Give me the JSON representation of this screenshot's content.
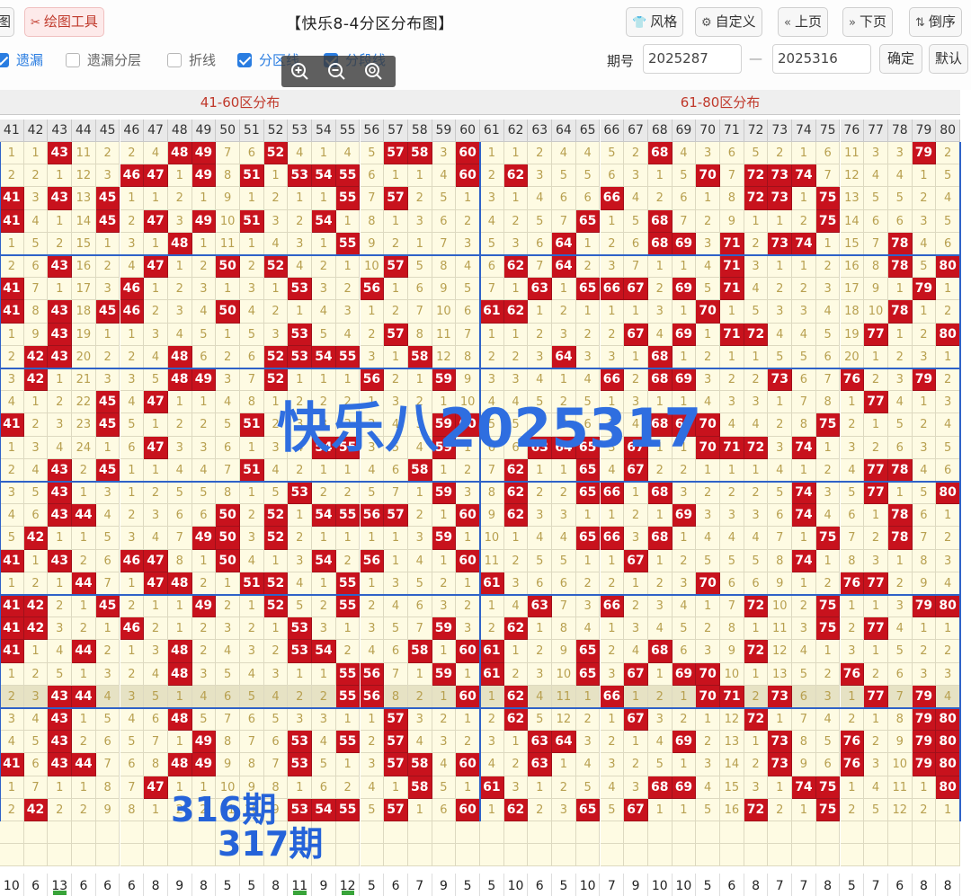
{
  "toolbar": {
    "left_partial_label": "图",
    "draw_tool_label": "绘图工具",
    "title": "【快乐8-4分区分布图】",
    "style_label": "风格",
    "custom_label": "自定义",
    "prev_label": "上页",
    "next_label": "下页",
    "reverse_label": "倒序",
    "confirm_label": "确定",
    "default_label": "默认",
    "issue_label": "期号",
    "issue_from": "2025287",
    "issue_to": "2025316",
    "dash": "—"
  },
  "options": [
    {
      "label": "遗漏",
      "checked": true
    },
    {
      "label": "遗漏分层",
      "checked": false
    },
    {
      "label": "折线",
      "checked": false
    },
    {
      "label": "分区线",
      "checked": true
    },
    {
      "label": "分段线",
      "checked": true
    }
  ],
  "zones": [
    {
      "label": "41-60区分布"
    },
    {
      "label": "61-80区分布"
    }
  ],
  "columns": [
    41,
    42,
    43,
    44,
    45,
    46,
    47,
    48,
    49,
    50,
    51,
    52,
    53,
    54,
    55,
    56,
    57,
    58,
    59,
    60,
    61,
    62,
    63,
    64,
    65,
    66,
    67,
    68,
    69,
    70,
    71,
    72,
    73,
    74,
    75,
    76,
    77,
    78,
    79,
    80
  ],
  "rows": [
    [
      1,
      1,
      "H",
      11,
      2,
      2,
      4,
      "H",
      "H",
      7,
      6,
      "H",
      4,
      1,
      4,
      5,
      "H",
      "H",
      3,
      "H",
      1,
      1,
      2,
      4,
      4,
      5,
      2,
      "H",
      4,
      3,
      6,
      5,
      2,
      1,
      6,
      11,
      3,
      3,
      "H",
      2
    ],
    [
      2,
      2,
      1,
      12,
      3,
      "H",
      "H",
      1,
      "H",
      8,
      "H",
      1,
      "H",
      "H",
      "H",
      6,
      1,
      1,
      4,
      "H",
      2,
      "H",
      3,
      5,
      5,
      6,
      3,
      1,
      5,
      "H",
      7,
      "H",
      "H",
      "H",
      7,
      12,
      4,
      4,
      1,
      5
    ],
    [
      "H",
      3,
      "H",
      13,
      "H",
      1,
      1,
      2,
      1,
      9,
      1,
      2,
      1,
      1,
      "H",
      7,
      "H",
      2,
      5,
      1,
      3,
      1,
      4,
      6,
      6,
      "H",
      4,
      2,
      6,
      1,
      8,
      "H",
      "H",
      1,
      "H",
      13,
      5,
      5,
      2,
      4
    ],
    [
      "H",
      4,
      1,
      14,
      "H",
      2,
      "H",
      3,
      "H",
      10,
      "H",
      3,
      2,
      "H",
      1,
      8,
      1,
      3,
      6,
      2,
      4,
      2,
      5,
      7,
      "H",
      1,
      5,
      "H",
      7,
      2,
      9,
      1,
      1,
      2,
      "H",
      14,
      6,
      6,
      3,
      5
    ],
    [
      1,
      5,
      2,
      15,
      1,
      3,
      1,
      "H",
      1,
      11,
      1,
      4,
      3,
      1,
      "H",
      9,
      2,
      1,
      7,
      3,
      5,
      3,
      6,
      "H",
      1,
      2,
      6,
      "H",
      "H",
      3,
      "H",
      2,
      "H",
      "H",
      1,
      15,
      7,
      "H",
      4,
      6
    ],
    [
      2,
      6,
      "H",
      16,
      2,
      4,
      "H",
      1,
      2,
      "H",
      2,
      "H",
      4,
      2,
      1,
      10,
      "H",
      5,
      8,
      4,
      6,
      "H",
      7,
      "H",
      2,
      3,
      7,
      1,
      1,
      4,
      "H",
      3,
      1,
      1,
      2,
      16,
      8,
      "H",
      5,
      "H"
    ],
    [
      "H",
      7,
      1,
      17,
      3,
      "H",
      1,
      2,
      3,
      1,
      3,
      1,
      "H",
      3,
      2,
      "H",
      1,
      6,
      9,
      5,
      7,
      1,
      "H",
      1,
      "H",
      "H",
      "H",
      2,
      "H",
      5,
      "H",
      4,
      2,
      2,
      3,
      17,
      9,
      1,
      "H",
      1
    ],
    [
      "H",
      8,
      "H",
      18,
      "H",
      "H",
      2,
      3,
      4,
      "H",
      4,
      2,
      1,
      4,
      3,
      1,
      2,
      7,
      10,
      6,
      "H",
      "H",
      1,
      2,
      1,
      1,
      1,
      3,
      1,
      "H",
      1,
      5,
      3,
      3,
      4,
      18,
      10,
      "H",
      1,
      2
    ],
    [
      1,
      9,
      "H",
      19,
      1,
      1,
      3,
      4,
      5,
      1,
      5,
      3,
      "H",
      5,
      4,
      2,
      "H",
      8,
      11,
      7,
      1,
      1,
      2,
      3,
      2,
      2,
      "H",
      4,
      "H",
      1,
      "H",
      "H",
      4,
      4,
      5,
      19,
      "H",
      1,
      2,
      "H"
    ],
    [
      2,
      "H",
      "H",
      20,
      2,
      2,
      4,
      "H",
      6,
      2,
      6,
      "H",
      "H",
      "H",
      "H",
      3,
      1,
      "H",
      12,
      8,
      2,
      2,
      3,
      "H",
      3,
      3,
      1,
      "H",
      1,
      2,
      1,
      1,
      5,
      5,
      6,
      20,
      1,
      2,
      3,
      1
    ],
    [
      3,
      "H",
      1,
      21,
      3,
      3,
      5,
      "H",
      "H",
      3,
      7,
      "H",
      1,
      1,
      1,
      "H",
      2,
      1,
      "H",
      9,
      3,
      3,
      4,
      1,
      4,
      "H",
      2,
      "H",
      "H",
      3,
      2,
      2,
      "H",
      6,
      7,
      "H",
      2,
      3,
      "H",
      2
    ],
    [
      4,
      1,
      2,
      22,
      "H",
      4,
      "H",
      1,
      1,
      4,
      8,
      1,
      2,
      2,
      2,
      1,
      3,
      2,
      1,
      10,
      4,
      4,
      5,
      2,
      5,
      1,
      3,
      1,
      1,
      4,
      3,
      3,
      1,
      7,
      8,
      1,
      "H",
      4,
      1,
      3
    ],
    [
      "H",
      2,
      3,
      23,
      "H",
      5,
      1,
      2,
      2,
      5,
      "H",
      2,
      3,
      3,
      3,
      2,
      4,
      3,
      "H",
      "H",
      5,
      5,
      6,
      3,
      6,
      2,
      4,
      "H",
      "H",
      "H",
      4,
      4,
      2,
      8,
      "H",
      2,
      1,
      5,
      2,
      4
    ],
    [
      1,
      3,
      4,
      24,
      1,
      6,
      "H",
      3,
      3,
      6,
      1,
      3,
      4,
      "H",
      "H",
      3,
      5,
      4,
      "H",
      1,
      6,
      6,
      "H",
      "H",
      "H",
      3,
      "H",
      1,
      1,
      "H",
      "H",
      "H",
      3,
      "H",
      1,
      3,
      2,
      6,
      3,
      5
    ],
    [
      2,
      4,
      "H",
      2,
      "H",
      1,
      1,
      4,
      4,
      7,
      "H",
      4,
      2,
      1,
      1,
      4,
      6,
      "H",
      1,
      2,
      7,
      "H",
      1,
      1,
      "H",
      4,
      "H",
      2,
      2,
      1,
      1,
      1,
      4,
      1,
      2,
      4,
      "H",
      "H",
      4,
      6
    ],
    [
      3,
      5,
      "H",
      1,
      3,
      1,
      2,
      5,
      5,
      8,
      1,
      5,
      "H",
      2,
      2,
      5,
      7,
      1,
      "H",
      3,
      8,
      "H",
      2,
      2,
      "H",
      "H",
      1,
      "H",
      3,
      2,
      2,
      2,
      5,
      "H",
      3,
      5,
      "H",
      1,
      5,
      "H"
    ],
    [
      4,
      6,
      "H",
      "H",
      4,
      2,
      3,
      6,
      6,
      "H",
      2,
      "H",
      1,
      "H",
      "H",
      "H",
      "H",
      2,
      1,
      "H",
      9,
      "H",
      3,
      3,
      1,
      1,
      2,
      1,
      "H",
      3,
      3,
      3,
      6,
      "H",
      4,
      6,
      1,
      "H",
      6,
      1
    ],
    [
      5,
      "H",
      1,
      1,
      5,
      3,
      4,
      7,
      "H",
      "H",
      3,
      "H",
      2,
      1,
      1,
      1,
      1,
      3,
      "H",
      1,
      10,
      1,
      4,
      4,
      "H",
      "H",
      3,
      "H",
      1,
      4,
      4,
      4,
      7,
      1,
      "H",
      7,
      2,
      "H",
      7,
      2
    ],
    [
      "H",
      1,
      "H",
      2,
      6,
      "H",
      "H",
      8,
      1,
      "H",
      4,
      1,
      3,
      "H",
      2,
      "H",
      1,
      4,
      1,
      "H",
      11,
      2,
      5,
      5,
      1,
      1,
      "H",
      1,
      2,
      5,
      5,
      5,
      8,
      "H",
      1,
      8,
      3,
      1,
      8,
      3
    ],
    [
      1,
      2,
      1,
      "H",
      7,
      1,
      "H",
      "H",
      2,
      1,
      "H",
      "H",
      4,
      1,
      "H",
      1,
      3,
      5,
      2,
      1,
      "H",
      3,
      6,
      6,
      2,
      2,
      1,
      2,
      3,
      "H",
      6,
      6,
      9,
      1,
      2,
      "H",
      "H",
      2,
      9,
      4
    ],
    [
      "H",
      "H",
      2,
      1,
      "H",
      2,
      1,
      1,
      "H",
      2,
      1,
      "H",
      5,
      2,
      "H",
      2,
      4,
      6,
      3,
      2,
      1,
      4,
      "H",
      7,
      3,
      "H",
      2,
      3,
      4,
      1,
      7,
      "H",
      10,
      2,
      "H",
      1,
      1,
      3,
      "H",
      "H"
    ],
    [
      "H",
      "H",
      3,
      2,
      1,
      "H",
      2,
      1,
      2,
      3,
      2,
      1,
      "H",
      3,
      1,
      3,
      5,
      7,
      "H",
      3,
      2,
      "H",
      1,
      8,
      4,
      1,
      3,
      4,
      5,
      2,
      8,
      1,
      11,
      3,
      "H",
      2,
      "H",
      4,
      1,
      1
    ],
    [
      "H",
      1,
      4,
      "H",
      2,
      1,
      3,
      "H",
      2,
      4,
      3,
      2,
      "H",
      "H",
      2,
      4,
      6,
      "H",
      1,
      "H",
      "H",
      1,
      2,
      9,
      "H",
      2,
      4,
      "H",
      6,
      3,
      9,
      "H",
      12,
      4,
      1,
      3,
      1,
      5,
      2,
      2
    ],
    [
      1,
      2,
      5,
      1,
      3,
      2,
      4,
      "H",
      3,
      5,
      4,
      3,
      1,
      1,
      "H",
      "H",
      7,
      1,
      "H",
      1,
      "H",
      2,
      3,
      10,
      "H",
      3,
      "H",
      1,
      "H",
      "H",
      10,
      1,
      13,
      5,
      2,
      "H",
      2,
      6,
      3,
      3
    ],
    [
      2,
      3,
      "H",
      "H",
      4,
      3,
      5,
      1,
      4,
      6,
      5,
      4,
      2,
      2,
      "H",
      "H",
      8,
      2,
      1,
      "H",
      1,
      "H",
      4,
      11,
      1,
      "H",
      1,
      2,
      1,
      "H",
      "H",
      2,
      "H",
      6,
      3,
      1,
      "H",
      7,
      "H",
      4
    ],
    [
      3,
      4,
      "H",
      1,
      5,
      4,
      6,
      "H",
      5,
      7,
      6,
      5,
      3,
      3,
      1,
      1,
      "H",
      3,
      2,
      1,
      2,
      "H",
      5,
      12,
      2,
      1,
      "H",
      3,
      2,
      1,
      12,
      "H",
      1,
      7,
      4,
      2,
      1,
      8,
      "H",
      "H"
    ],
    [
      4,
      5,
      "H",
      2,
      6,
      5,
      7,
      1,
      "H",
      8,
      7,
      6,
      "H",
      4,
      "H",
      2,
      "H",
      4,
      3,
      2,
      3,
      1,
      "H",
      "H",
      3,
      2,
      1,
      4,
      "H",
      2,
      13,
      1,
      "H",
      8,
      5,
      "H",
      2,
      9,
      "H",
      "H"
    ],
    [
      "H",
      6,
      "H",
      "H",
      7,
      6,
      8,
      "H",
      "H",
      9,
      8,
      7,
      "H",
      5,
      1,
      3,
      "H",
      "H",
      4,
      "H",
      4,
      2,
      "H",
      1,
      4,
      3,
      2,
      5,
      1,
      3,
      14,
      2,
      "H",
      9,
      6,
      "H",
      3,
      10,
      "H",
      "H"
    ],
    [
      1,
      7,
      1,
      1,
      8,
      7,
      "H",
      1,
      1,
      10,
      9,
      8,
      1,
      6,
      2,
      4,
      1,
      "H",
      5,
      1,
      "H",
      3,
      1,
      2,
      5,
      4,
      3,
      "H",
      "H",
      4,
      15,
      3,
      1,
      "H",
      "H",
      1,
      4,
      11,
      1,
      "H"
    ],
    [
      2,
      "H",
      2,
      2,
      9,
      8,
      1,
      2,
      2,
      11,
      10,
      9,
      "H",
      "H",
      "H",
      5,
      "H",
      1,
      6,
      "H",
      1,
      "H",
      2,
      3,
      "H",
      5,
      "H",
      1,
      1,
      5,
      16,
      "H",
      2,
      1,
      "H",
      2,
      5,
      12,
      2,
      1
    ]
  ],
  "highlight_row": 24,
  "stats": [
    "10",
    "6",
    "13",
    "6",
    "6",
    "6",
    "8",
    "9",
    "8",
    "5",
    "5",
    "8",
    "11",
    "9",
    "12",
    "5",
    "6",
    "7",
    "9",
    "5",
    "5",
    "10",
    "6",
    "5",
    "10",
    "7",
    "9",
    "10",
    "10",
    "5",
    "6",
    "8",
    "7",
    "7",
    "8",
    "5",
    "7",
    "6",
    "8",
    "8"
  ],
  "stat_bars": [
    2,
    12,
    14
  ],
  "overlays": {
    "main_text": "快乐八2025317",
    "label_316": "316期",
    "label_317": "317期"
  },
  "colors": {
    "hit": "#c8121d",
    "miss_bg": "#fefbe3",
    "accent_blue": "#2a7de1",
    "zone_text": "#c0392b"
  }
}
